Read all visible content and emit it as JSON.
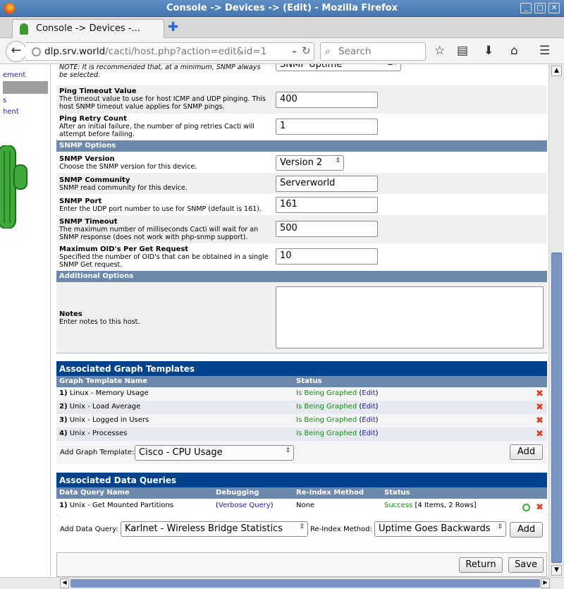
{
  "window": {
    "title": "Console -> Devices -> (Edit) - Mozilla Firefox"
  },
  "tab": {
    "label": "Console -> Devices -..."
  },
  "nav": {
    "url_host": "dlp.srv.world",
    "url_path": "/cacti/host.php?action=edit&id=1",
    "search_placeholder": "Search"
  },
  "sidebar": {
    "items": [
      "ement",
      "s",
      "hent"
    ]
  },
  "form": {
    "partial_note": "NOTE: It is recommended that, at a minimum, SNMP always be selected.",
    "partial_select": "SNMP Uptime",
    "ping_timeout": {
      "label": "Ping Timeout Value",
      "desc": "The timeout value to use for host ICMP and UDP pinging. This host SNMP timeout value applies for SNMP pings.",
      "value": "400"
    },
    "ping_retry": {
      "label": "Ping Retry Count",
      "desc": "After an initial failure, the number of ping retries Cacti will attempt before failing.",
      "value": "1"
    },
    "snmp_options_header": "SNMP Options",
    "snmp_version": {
      "label": "SNMP Version",
      "desc": "Choose the SNMP version for this device.",
      "value": "Version 2"
    },
    "snmp_community": {
      "label": "SNMP Community",
      "desc": "SNMP read community for this device.",
      "value": "Serverworld"
    },
    "snmp_port": {
      "label": "SNMP Port",
      "desc": "Enter the UDP port number to use for SNMP (default is 161).",
      "value": "161"
    },
    "snmp_timeout": {
      "label": "SNMP Timeout",
      "desc": "The maximum number of milliseconds Cacti will wait for an SNMP response (does not work with php-snmp support).",
      "value": "500"
    },
    "max_oids": {
      "label": "Maximum OID's Per Get Request",
      "desc": "Specified the number of OID's that can be obtained in a single SNMP Get request.",
      "value": "10"
    },
    "additional_header": "Additional Options",
    "notes": {
      "label": "Notes",
      "desc": "Enter notes to this host.",
      "value": ""
    }
  },
  "graph_templates": {
    "title": "Associated Graph Templates",
    "col_name": "Graph Template Name",
    "col_status": "Status",
    "rows": [
      {
        "num": "1)",
        "name": "Linux - Memory Usage",
        "status": "Is Being Graphed",
        "edit": "Edit"
      },
      {
        "num": "2)",
        "name": "Unix - Load Average",
        "status": "Is Being Graphed",
        "edit": "Edit"
      },
      {
        "num": "3)",
        "name": "Unix - Logged in Users",
        "status": "Is Being Graphed",
        "edit": "Edit"
      },
      {
        "num": "4)",
        "name": "Unix - Processes",
        "status": "Is Being Graphed",
        "edit": "Edit"
      }
    ],
    "add_label": "Add Graph Template:",
    "add_value": "Cisco - CPU Usage",
    "add_button": "Add"
  },
  "data_queries": {
    "title": "Associated Data Queries",
    "col_name": "Data Query Name",
    "col_debug": "Debugging",
    "col_reindex": "Re-Index Method",
    "col_status": "Status",
    "row": {
      "num": "1)",
      "name": "Unix - Get Mounted Partitions",
      "debug": "Verbose Query",
      "reindex": "None",
      "status": "Success",
      "status_detail": "[4 Items, 2 Rows]"
    },
    "add_label": "Add Data Query:",
    "add_value": "Karlnet - Wireless Bridge Statistics",
    "reindex_label": "Re-Index Method:",
    "reindex_value": "Uptime Goes Backwards",
    "add_button": "Add"
  },
  "footer": {
    "return_button": "Return",
    "save_button": "Save"
  }
}
